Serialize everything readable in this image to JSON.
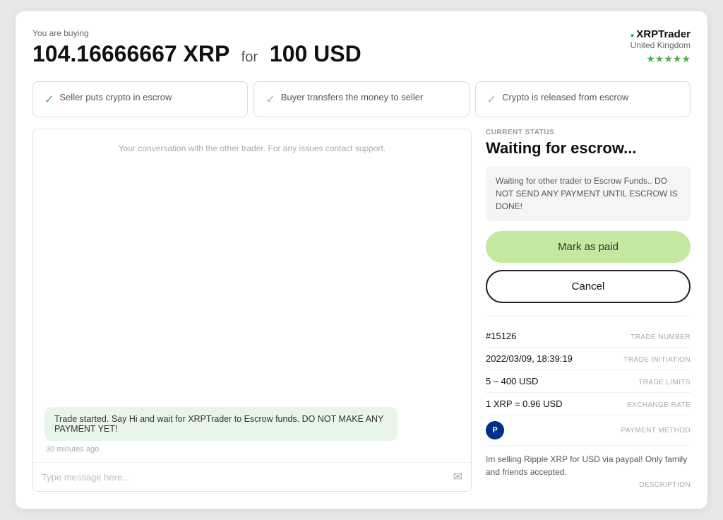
{
  "header": {
    "buying_label": "You are buying",
    "amount": "104.16666667 XRP",
    "for_text": "for",
    "price": "100 USD"
  },
  "trader": {
    "name": "XRPTrader",
    "country": "United Kingdom",
    "stars": "★★★★★"
  },
  "steps": [
    {
      "label": "Seller puts crypto in escrow",
      "active": true
    },
    {
      "label": "Buyer transfers the money to seller",
      "active": false
    },
    {
      "label": "Crypto is released from escrow",
      "active": false
    }
  ],
  "chat": {
    "placeholder_text": "Your conversation with the other trader. For any issues contact support.",
    "bubble_text": "Trade started. Say Hi and wait for XRPTrader to Escrow funds. DO NOT MAKE ANY PAYMENT YET!",
    "time_ago": "30 minutes ago",
    "input_placeholder": "Type message here..."
  },
  "status": {
    "current_label": "CURRENT STATUS",
    "title": "Waiting for escrow...",
    "warning": "Waiting for other trader to Escrow Funds.. DO NOT SEND ANY PAYMENT UNTIL ESCROW IS DONE!",
    "mark_paid_label": "Mark as paid",
    "cancel_label": "Cancel"
  },
  "trade_info": {
    "trade_number": {
      "value": "#15126",
      "label": "TRADE NUMBER"
    },
    "trade_initiation": {
      "value": "2022/03/09, 18:39:19",
      "label": "TRADE INITIATION"
    },
    "trade_limits": {
      "value": "5 – 400 USD",
      "label": "TRADE LIMITS"
    },
    "exchange_rate": {
      "value": "1 XRP = 0.96 USD",
      "label": "EXCHANGE RATE"
    },
    "payment_method_label": "PAYMENT METHOD",
    "description": {
      "text": "Im selling Ripple XRP for USD via paypal! Only family and friends accepted.",
      "label": "DESCRIPTION"
    }
  }
}
